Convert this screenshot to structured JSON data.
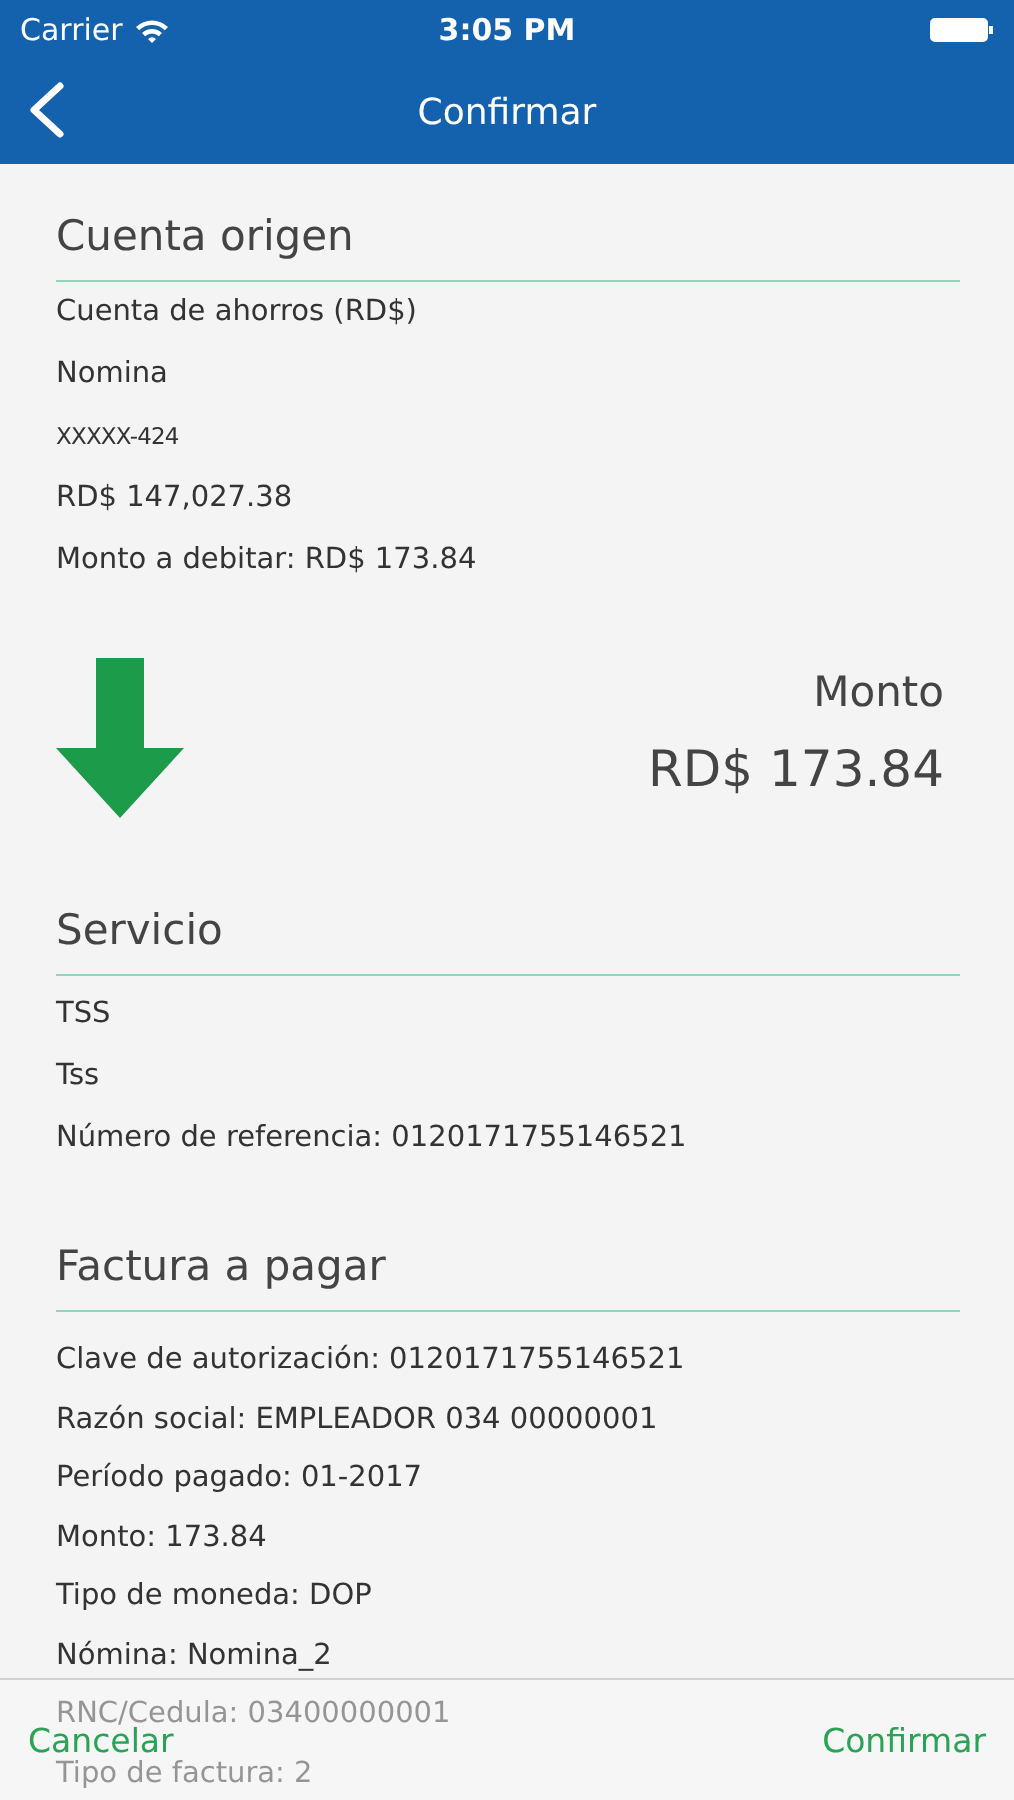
{
  "status_bar": {
    "carrier": "Carrier",
    "time": "3:05 PM"
  },
  "nav_bar": {
    "title": "Confirmar"
  },
  "source_account": {
    "title": "Cuenta origen",
    "lines": [
      {
        "text": "Cuenta de ahorros (RD$)",
        "kind": "text"
      },
      {
        "text": "Nomina",
        "kind": "text"
      },
      {
        "text": "XXXXX-424",
        "kind": "masked"
      },
      {
        "text": "RD$ 147,027.38",
        "kind": "text"
      },
      {
        "text": "Monto a debitar: RD$ 173.84",
        "kind": "text"
      }
    ]
  },
  "amount": {
    "label": "Monto",
    "value": "RD$ 173.84"
  },
  "service": {
    "title": "Servicio",
    "lines": [
      {
        "text": "TSS",
        "kind": "text"
      },
      {
        "text": "Tss",
        "kind": "text"
      },
      {
        "text": "Número de referencia: 0120171755146521",
        "kind": "text"
      }
    ]
  },
  "invoice": {
    "title": "Factura a pagar",
    "lines": [
      {
        "text": "Clave de autorización: 0120171755146521",
        "kind": "text"
      },
      {
        "text": "Razón social: EMPLEADOR 034 00000001",
        "kind": "text"
      },
      {
        "text": "Período pagado: 01-2017",
        "kind": "text"
      },
      {
        "text": "Monto: 173.84",
        "kind": "text"
      },
      {
        "text": "Tipo de moneda: DOP",
        "kind": "text"
      },
      {
        "text": "Nómina: Nomina_2",
        "kind": "text"
      },
      {
        "text": "RNC/Cedula: 03400000001",
        "kind": "text"
      },
      {
        "text": "Tipo de factura: 2",
        "kind": "text"
      }
    ]
  },
  "bottom_bar": {
    "cancel": "Cancelar",
    "confirm": "Confirmar"
  }
}
